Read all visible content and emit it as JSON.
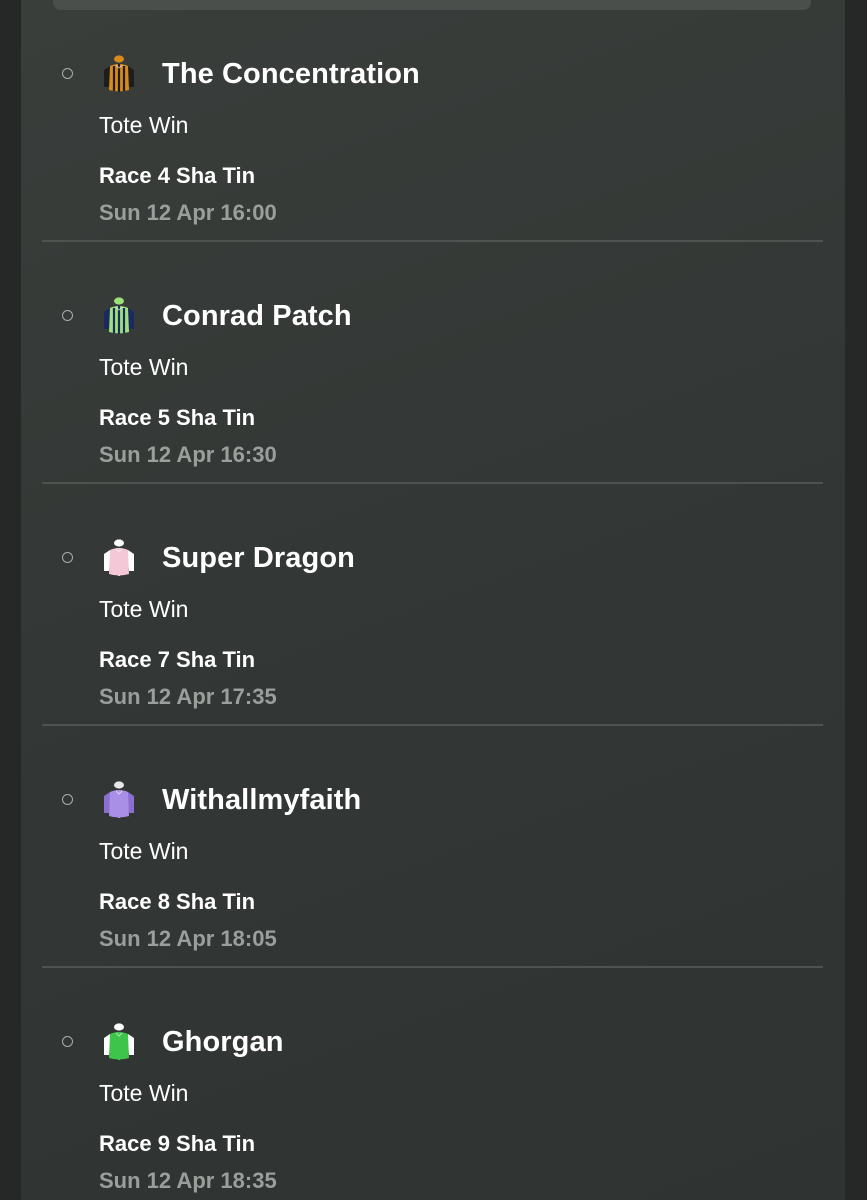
{
  "selections": [
    {
      "runner": "The Concentration",
      "market": "Tote Win",
      "race": "Race 4 Sha Tin",
      "time": "Sun 12 Apr 16:00",
      "silk_icon": "jockey-silk-icon",
      "silk_colors": {
        "body": "#d88a1a",
        "pattern": "#1d1d1d",
        "sleeves": "#1d1d1d",
        "cap": "#d88a1a"
      }
    },
    {
      "runner": "Conrad Patch",
      "market": "Tote Win",
      "race": "Race 5 Sha Tin",
      "time": "Sun 12 Apr 16:30",
      "silk_icon": "jockey-silk-icon",
      "silk_colors": {
        "body": "#9fe07a",
        "pattern": "#1a2a60",
        "sleeves": "#1a2a60",
        "cap": "#9fe07a"
      }
    },
    {
      "runner": "Super Dragon",
      "market": "Tote Win",
      "race": "Race 7 Sha Tin",
      "time": "Sun 12 Apr 17:35",
      "silk_icon": "jockey-silk-icon",
      "silk_colors": {
        "body": "#f4c8d6",
        "pattern": "#f4c8d6",
        "sleeves": "#ffffff",
        "cap": "#ffffff"
      }
    },
    {
      "runner": "Withallmyfaith",
      "market": "Tote Win",
      "race": "Race 8 Sha Tin",
      "time": "Sun 12 Apr 18:05",
      "silk_icon": "jockey-silk-icon",
      "silk_colors": {
        "body": "#a98fe6",
        "pattern": "#a98fe6",
        "sleeves": "#8a6fd0",
        "cap": "#e8e8e8"
      }
    },
    {
      "runner": "Ghorgan",
      "market": "Tote Win",
      "race": "Race 9 Sha Tin",
      "time": "Sun 12 Apr 18:35",
      "silk_icon": "jockey-silk-icon",
      "silk_colors": {
        "body": "#3ec44a",
        "pattern": "#3ec44a",
        "sleeves": "#ffffff",
        "cap": "#ffffff"
      }
    }
  ]
}
